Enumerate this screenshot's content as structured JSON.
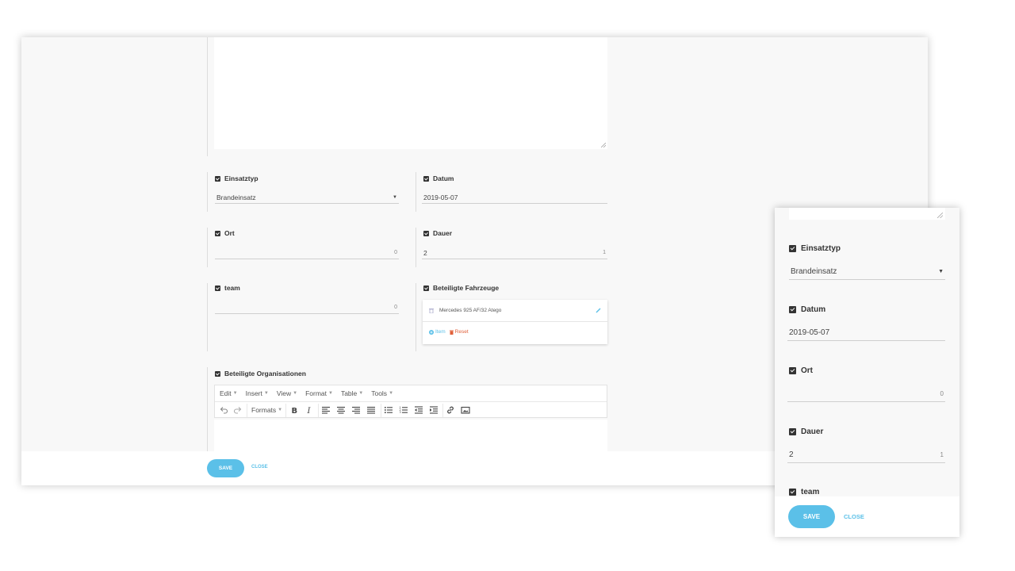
{
  "desktop": {
    "einsatztyp": {
      "label": "Einsatztyp",
      "value": "Brandeinsatz",
      "arrow": "▼"
    },
    "datum": {
      "label": "Datum",
      "value": "2019-05-07"
    },
    "ort": {
      "label": "Ort",
      "value": "",
      "counter": "0"
    },
    "dauer": {
      "label": "Dauer",
      "value": "2",
      "counter": "1"
    },
    "team": {
      "label": "team",
      "value": "",
      "counter": "0"
    },
    "fahrzeuge": {
      "label": "Beteiligte Fahrzeuge",
      "item": "Mercedes 925 AF/32 Atego",
      "add_label": "Item",
      "reset_label": "Reset"
    },
    "organisationen": {
      "label": "Beteiligte Organisationen",
      "menu": [
        "Edit",
        "Insert",
        "View",
        "Format",
        "Table",
        "Tools"
      ],
      "formats_label": "Formats"
    },
    "save_label": "SAVE",
    "close_label": "CLOSE"
  },
  "mobile": {
    "einsatztyp": {
      "label": "Einsatztyp",
      "value": "Brandeinsatz",
      "arrow": "▼"
    },
    "datum": {
      "label": "Datum",
      "value": "2019-05-07"
    },
    "ort": {
      "label": "Ort",
      "value": "",
      "counter": "0"
    },
    "dauer": {
      "label": "Dauer",
      "value": "2",
      "counter": "1"
    },
    "team": {
      "label": "team"
    },
    "save_label": "SAVE",
    "close_label": "CLOSE"
  },
  "colors": {
    "accent": "#5bc0e8",
    "danger": "#e0603a",
    "background": "#f8f8f8"
  }
}
